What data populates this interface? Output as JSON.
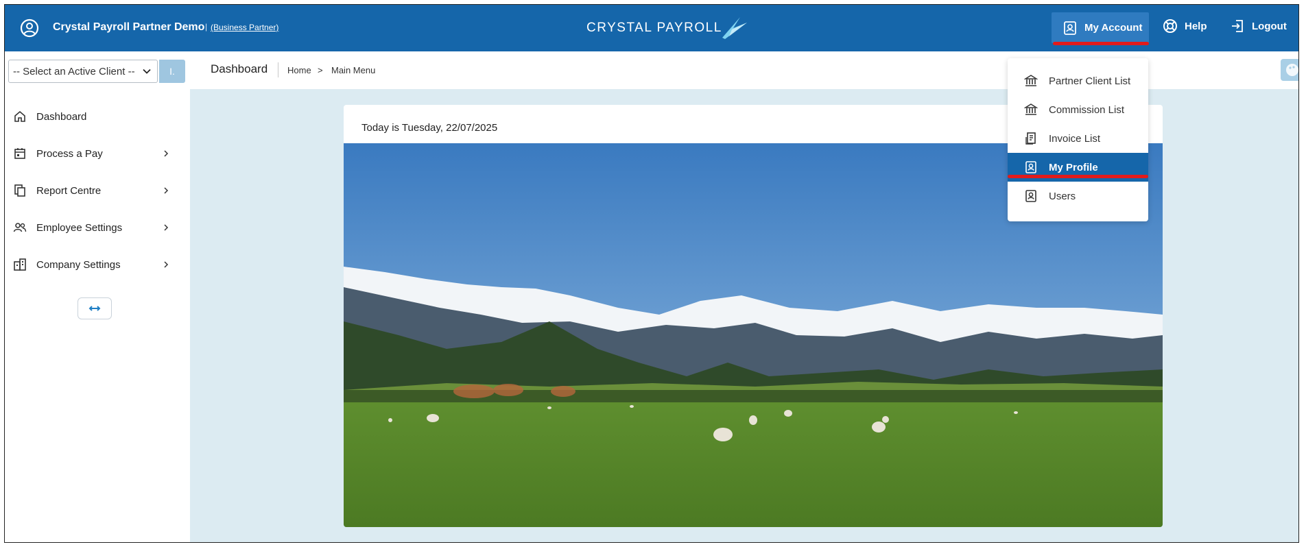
{
  "header": {
    "company_name": "Crystal Payroll Partner Demo",
    "separator": "|",
    "partner_link": "(Business Partner)",
    "brand": "CRYSTAL PAYROLL",
    "account_label": "My Account",
    "help_label": "Help",
    "logout_label": "Logout"
  },
  "sidebar": {
    "client_select_value": "-- Select an Active Client --",
    "client_go_label": "I.",
    "items": [
      {
        "label": "Dashboard",
        "icon": "home-icon",
        "has_submenu": false
      },
      {
        "label": "Process a Pay",
        "icon": "calendar-icon",
        "has_submenu": true
      },
      {
        "label": "Report Centre",
        "icon": "documents-icon",
        "has_submenu": true
      },
      {
        "label": "Employee Settings",
        "icon": "people-icon",
        "has_submenu": true
      },
      {
        "label": "Company Settings",
        "icon": "building-icon",
        "has_submenu": true
      }
    ],
    "collapse_icon": "double-arrow-icon"
  },
  "breadcrumb": {
    "title": "Dashboard",
    "home": "Home",
    "arrow": ">",
    "current": "Main Menu"
  },
  "main": {
    "today_text": "Today is Tuesday, 22/07/2025"
  },
  "account_menu": {
    "items": [
      {
        "label": "Partner Client List",
        "icon": "bank-icon"
      },
      {
        "label": "Commission List",
        "icon": "bank-icon"
      },
      {
        "label": "Invoice List",
        "icon": "invoice-icon"
      },
      {
        "label": "My Profile",
        "icon": "profile-icon",
        "active": true
      },
      {
        "label": "Users",
        "icon": "profile-icon"
      }
    ]
  },
  "colors": {
    "header_blue": "#1566aa",
    "highlight_red": "#e21b1b",
    "main_bg": "#dcebf2"
  }
}
